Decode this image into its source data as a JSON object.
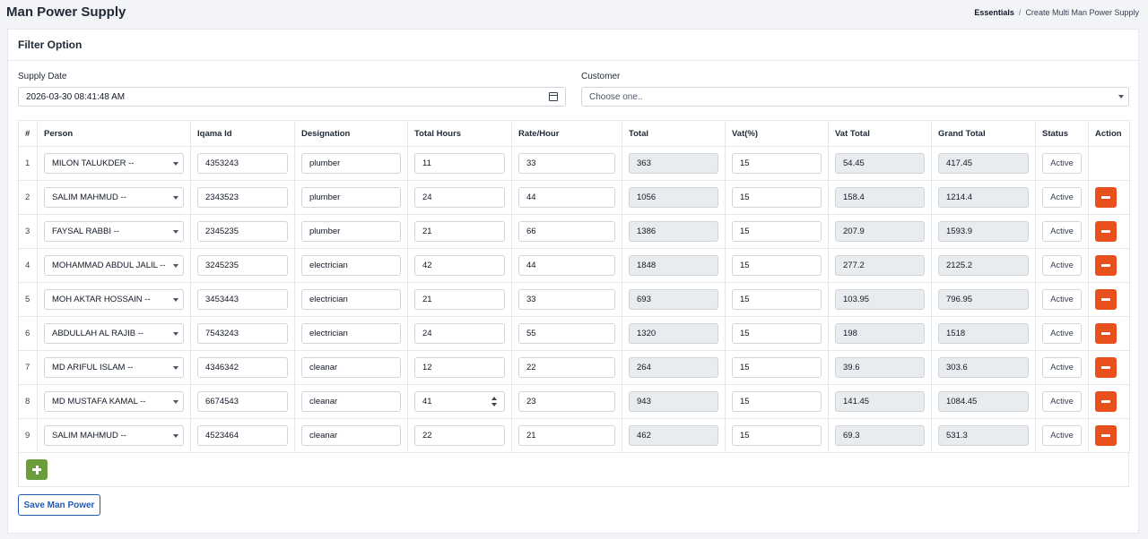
{
  "header": {
    "title": "Man Power Supply",
    "breadcrumb": [
      "Essentials",
      "Create Multi Man Power Supply"
    ]
  },
  "card": {
    "title": "Filter Option"
  },
  "filters": {
    "supply_date_label": "Supply Date",
    "supply_date_value": "2026-03-30 08:41:48 AM",
    "customer_label": "Customer",
    "customer_placeholder": "Choose one.."
  },
  "table": {
    "columns": [
      "#",
      "Person",
      "Iqama Id",
      "Designation",
      "Total Hours",
      "Rate/Hour",
      "Total",
      "Vat(%)",
      "Vat Total",
      "Grand Total",
      "Status",
      "Action"
    ],
    "rows": [
      {
        "n": "1",
        "person": "MILON TALUKDER --",
        "iqama": "4353243",
        "designation": "plumber",
        "hours": "11",
        "rate": "33",
        "total": "363",
        "vat": "15",
        "vat_total": "54.45",
        "grand_total": "417.45",
        "status": "Active",
        "removable": false
      },
      {
        "n": "2",
        "person": "SALIM MAHMUD --",
        "iqama": "2343523",
        "designation": "plumber",
        "hours": "24",
        "rate": "44",
        "total": "1056",
        "vat": "15",
        "vat_total": "158.4",
        "grand_total": "1214.4",
        "status": "Active",
        "removable": true
      },
      {
        "n": "3",
        "person": "FAYSAL RABBI --",
        "iqama": "2345235",
        "designation": "plumber",
        "hours": "21",
        "rate": "66",
        "total": "1386",
        "vat": "15",
        "vat_total": "207.9",
        "grand_total": "1593.9",
        "status": "Active",
        "removable": true
      },
      {
        "n": "4",
        "person": "MOHAMMAD ABDUL JALIL --",
        "iqama": "3245235",
        "designation": "electrician",
        "hours": "42",
        "rate": "44",
        "total": "1848",
        "vat": "15",
        "vat_total": "277.2",
        "grand_total": "2125.2",
        "status": "Active",
        "removable": true
      },
      {
        "n": "5",
        "person": "MOH AKTAR HOSSAIN --",
        "iqama": "3453443",
        "designation": "electrician",
        "hours": "21",
        "rate": "33",
        "total": "693",
        "vat": "15",
        "vat_total": "103.95",
        "grand_total": "796.95",
        "status": "Active",
        "removable": true
      },
      {
        "n": "6",
        "person": "ABDULLAH AL RAJIB --",
        "iqama": "7543243",
        "designation": "electrician",
        "hours": "24",
        "rate": "55",
        "total": "1320",
        "vat": "15",
        "vat_total": "198",
        "grand_total": "1518",
        "status": "Active",
        "removable": true
      },
      {
        "n": "7",
        "person": "MD ARIFUL ISLAM --",
        "iqama": "4346342",
        "designation": "cleanar",
        "hours": "12",
        "rate": "22",
        "total": "264",
        "vat": "15",
        "vat_total": "39.6",
        "grand_total": "303.6",
        "status": "Active",
        "removable": true
      },
      {
        "n": "8",
        "person": "MD MUSTAFA KAMAL --",
        "iqama": "6674543",
        "designation": "cleanar",
        "hours": "41",
        "rate": "23",
        "total": "943",
        "vat": "15",
        "vat_total": "141.45",
        "grand_total": "1084.45",
        "status": "Active",
        "removable": true,
        "hours_spinner": true
      },
      {
        "n": "9",
        "person": "SALIM MAHMUD --",
        "iqama": "4523464",
        "designation": "cleanar",
        "hours": "22",
        "rate": "21",
        "total": "462",
        "vat": "15",
        "vat_total": "69.3",
        "grand_total": "531.3",
        "status": "Active",
        "removable": true
      }
    ]
  },
  "actions": {
    "save_label": "Save Man Power"
  },
  "icons": {
    "remove": "minus-icon",
    "add": "plus-icon",
    "calendar": "calendar-icon",
    "dropdown": "chevron-down-icon"
  },
  "colors": {
    "remove_button": "#e8501d",
    "add_button": "#6b9e3b",
    "save_button": "#1e5bb8"
  }
}
